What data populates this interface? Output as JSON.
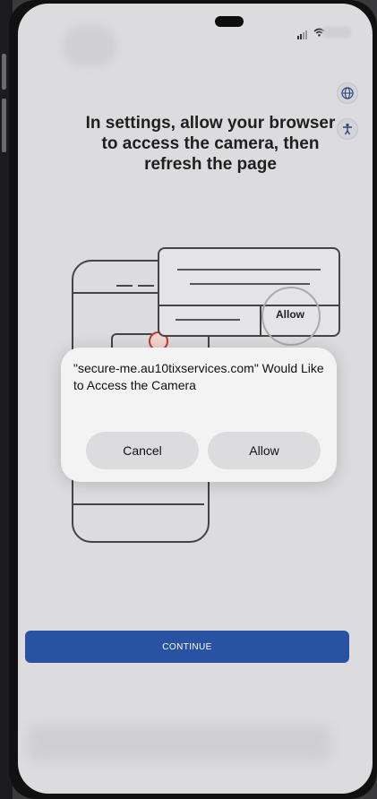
{
  "status_bar": {
    "wifi_icon": "wifi-icon",
    "signal_icon": "cellular-signal-icon"
  },
  "toolbar": {
    "language_icon": "globe-icon",
    "accessibility_icon": "accessibility-icon"
  },
  "instruction": {
    "heading": "In settings, allow your browser to access the camera, then refresh the page"
  },
  "illustration": {
    "card_allow_label": "Allow"
  },
  "permission_dialog": {
    "message": "\"secure-me.au10tixservices.com\" Would Like to Access the Camera",
    "cancel_label": "Cancel",
    "allow_label": "Allow"
  },
  "footer": {
    "continue_label": "CONTINUE"
  },
  "colors": {
    "primary_button": "#2952a3",
    "screen_background": "#dcdcde",
    "dialog_background": "#f3f3f4",
    "error_accent": "#c0392b"
  }
}
